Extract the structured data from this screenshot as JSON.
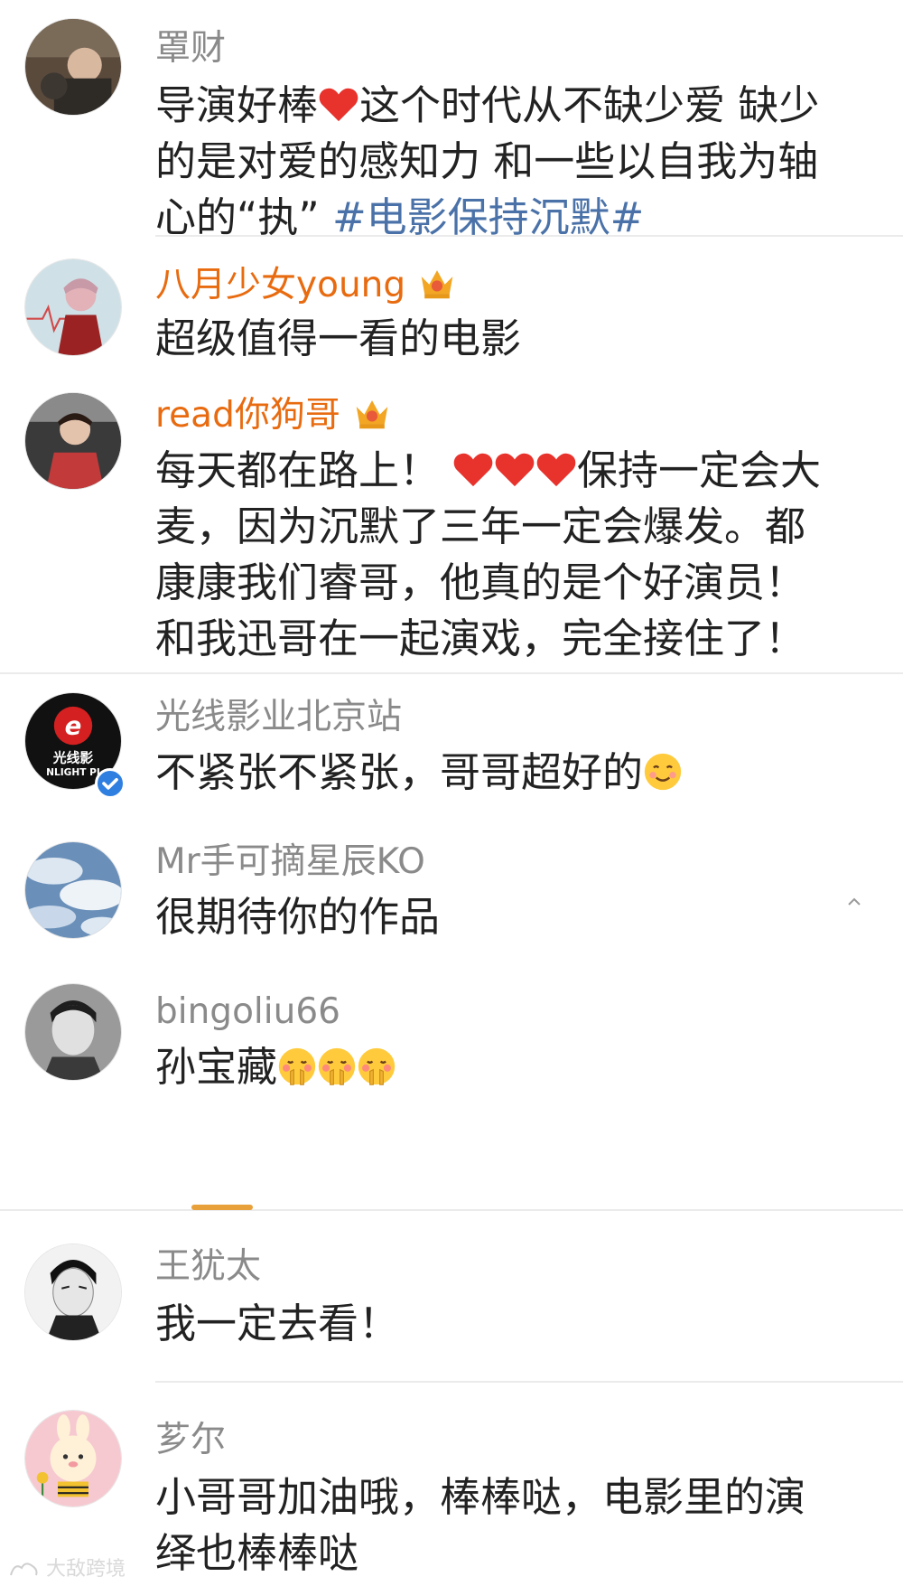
{
  "comments": [
    {
      "username": "罩财",
      "text_lines": [
        "导演好棒",
        "这个时代从不缺少爱 缺少",
        "的是对爱的感知力 和一些以自我为轴",
        "心的“执”"
      ],
      "hashtag": "#电影保持沉默#",
      "vip": false
    },
    {
      "username": "八月少女young",
      "text_lines": [
        "超级值得一看的电影"
      ],
      "vip": true
    },
    {
      "username": "read你狗哥",
      "text_lines": [
        "每天都在路上！",
        "保持一定会大",
        "麦，因为沉默了三年一定会爆发。都",
        "康康我们睿哥，他真的是个好演员！",
        "和我迅哥在一起演戏，完全接住了！"
      ],
      "vip": true
    },
    {
      "username": "光线影业北京站",
      "text_lines": [
        "不紧张不紧张，哥哥超好的"
      ],
      "avatar_text": "光线影",
      "avatar_subtext": "NLIGHT PI",
      "verified": true
    },
    {
      "username": "Mr手可摘星辰KO",
      "text_lines": [
        "很期待你的作品"
      ]
    },
    {
      "username": "bingoliu66",
      "text_lines": [
        "孙宝藏"
      ]
    },
    {
      "username": "王犹太",
      "text_lines": [
        "我一定去看！"
      ]
    },
    {
      "username": "芗尔",
      "text_lines": [
        "小哥哥加油哦，棒棒哒，电影里的演",
        "绎也棒棒哒"
      ]
    }
  ],
  "watermark": "大敌跨境",
  "colors": {
    "username": "#8a8a8a",
    "vip_username": "#e86b10",
    "hashtag": "#4a72a8",
    "text": "#222222",
    "heart": "#e8322c",
    "verified": "#2f7fe0",
    "tab_indicator": "#e8a03a"
  },
  "icons": {
    "heart": "heart-icon",
    "crown": "vip-crown-icon",
    "smile": "smile-emoji-icon",
    "blush": "blush-emoji-icon",
    "verified": "verified-badge-icon"
  }
}
